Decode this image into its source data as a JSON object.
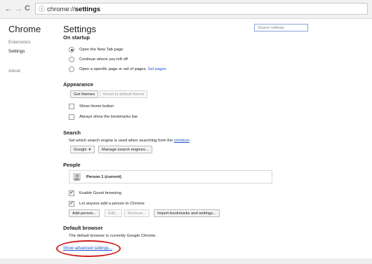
{
  "browser": {
    "back_glyph": "←",
    "forward_glyph": "→",
    "reload_glyph": "C",
    "info_glyph": "ⓘ",
    "url_prefix": "chrome://",
    "url_host": "settings"
  },
  "sidebar": {
    "title": "Chrome",
    "items": [
      {
        "label": "Extensions"
      },
      {
        "label": "Settings"
      },
      {
        "label": "About"
      }
    ]
  },
  "header": {
    "title": "Settings",
    "search_placeholder": "Search settings"
  },
  "on_startup": {
    "title": "On startup",
    "options": [
      {
        "label": "Open the New Tab page",
        "checked": true
      },
      {
        "label": "Continue where you left off",
        "checked": false
      },
      {
        "label": "Open a specific page or set of pages.",
        "link": "Set pages",
        "checked": false
      }
    ]
  },
  "appearance": {
    "title": "Appearance",
    "get_themes": "Get themes",
    "reset_theme": "Reset to default theme",
    "show_home": "Show Home button",
    "show_bookmarks": "Always show the bookmarks bar"
  },
  "search": {
    "title": "Search",
    "description": "Set which search engine is used when searching from the",
    "description_link": "omnibox",
    "description_end": ".",
    "engine": "Google",
    "manage": "Manage search engines..."
  },
  "people": {
    "title": "People",
    "person": "Person 1 (current)",
    "guest": "Enable Guest browsing",
    "add_anyone": "Let anyone add a person to Chrome",
    "add_person": "Add person...",
    "edit": "Edit...",
    "remove": "Remove...",
    "import": "Import bookmarks and settings..."
  },
  "default_browser": {
    "title": "Default browser",
    "status": "The default browser is currently Google Chrome."
  },
  "advanced": {
    "label": "Show advanced settings..."
  },
  "colors": {
    "link": "#1a55c9",
    "annotation": "#d01f1f"
  }
}
